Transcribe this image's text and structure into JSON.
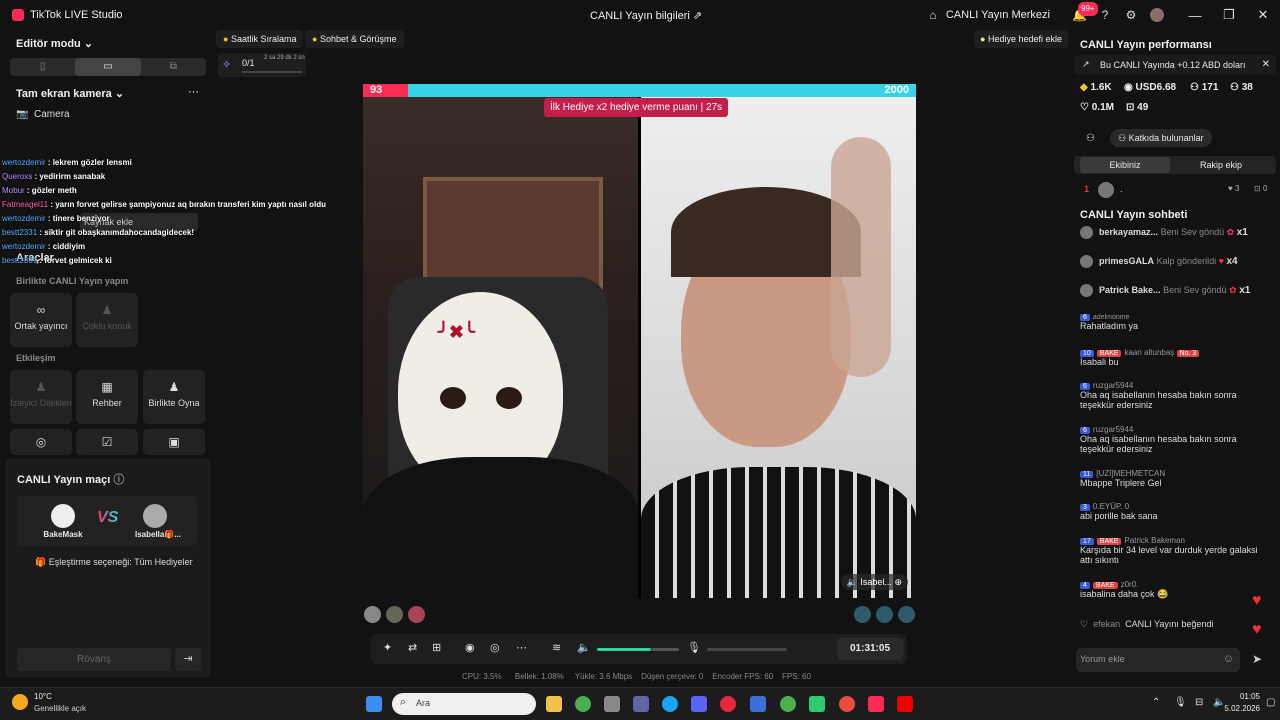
{
  "app": {
    "title": "TikTok LIVE Studio",
    "window_title": "CANLI Yayın bilgileri",
    "live_center": "CANLI Yayın Merkezi",
    "notif_count": "99+"
  },
  "left": {
    "editor_mode": "Editör modu",
    "camera_section": "Tam ekran kamera",
    "camera_item": "Camera",
    "add_source_tip": "Kaynak ekle",
    "tools_title": "Araçlar",
    "together_title": "Birlikte CANLI Yayın yapın",
    "tools_together": [
      {
        "label": "Ortak yayıncı",
        "icon": "∞",
        "enabled": true
      },
      {
        "label": "Çoklu konuk",
        "icon": "♟",
        "enabled": false
      }
    ],
    "interaction_title": "Etkileşim",
    "tools_interaction": [
      {
        "label": "İzleyici Dilekleri",
        "icon": "♟",
        "enabled": false
      },
      {
        "label": "Rehber",
        "icon": "▦",
        "enabled": true
      },
      {
        "label": "Birlikte Oyna",
        "icon": "♟",
        "enabled": true
      }
    ],
    "match_title": "CANLI Yayın maçı",
    "player_left": "BakeMask",
    "player_right": "Isabella🎁...",
    "vs": "VS",
    "pairing": "Eşleştirme seçeneği: Tüm Hediyeler",
    "rematch": "Rövanş"
  },
  "overlay_chat": [
    {
      "user": "wertozdemir",
      "msg": ": lekrem gözler lensmi"
    },
    {
      "user": "Queroxs",
      "msg": ": yedirirm sanabak"
    },
    {
      "user": "Mobur",
      "msg": ": gözler meth"
    },
    {
      "user": "Fatmeagel11",
      "msg": ": yarın forvet gelirse şampiyonuz aq bırakın transferi kim yaptı nasıl oldu"
    },
    {
      "user": "wertozdemir",
      "msg": ": tinere benziyor"
    },
    {
      "user": "bestt2331",
      "msg": ": siktir git obaşkanımdahocandagidecek!"
    },
    {
      "user": "wertozdemir",
      "msg": ": ciddiyim"
    },
    {
      "user": "bestt2331",
      "msg": ": forvet gelmicek ki"
    }
  ],
  "top_tabs": {
    "hourly": "Saatlik Sıralama",
    "chat_meet": "Sohbet & Görüşme",
    "goal": "0/1",
    "goal_timer": "2 sa 29 dk 2 sn",
    "add_gift_goal": "Hediye hedefi ekle"
  },
  "stage": {
    "score_left": "93",
    "score_right": "2000",
    "hint": "İlk Hediye x2 hediye verme puanı | 27s",
    "guest_label": "Isabel...",
    "timer": "01:31:05"
  },
  "stats": {
    "cpu": "CPU: 3.5%",
    "mem": "Bellek: 1.08%",
    "upload": "Yükle: 3.6 Mbps",
    "dropped": "Düşen çerçeve: 0",
    "encoder_fps": "Encoder FPS: 60",
    "fps": "FPS: 60"
  },
  "right": {
    "perf_title": "CANLI Yayın performansı",
    "perf_note": "Bu CANLI Yayında +0.12 ABD doları",
    "coins": "1.6K",
    "usd": "USD6.68",
    "viewers": "171",
    "followers": "38",
    "likes": "0.1M",
    "gifts": "49",
    "contributors": "Katkıda bulunanlar",
    "tab_ours": "Ekibiniz",
    "tab_rival": "Rakip ekip",
    "rank_1": "1",
    "rank_name": ".",
    "rank_hearts": "3",
    "rank_gifts": "0",
    "chat_title": "CANLI Yayın sohbeti",
    "gift_events": [
      {
        "user": "berkayamaz...",
        "msg": "Beni Sev göndü",
        "count": "x1"
      },
      {
        "user": "primesGALA",
        "msg": "Kalp gönderildi",
        "count": "x4"
      },
      {
        "user": "Patrick Bake...",
        "msg": "Beni Sev göndü",
        "count": "x1"
      }
    ],
    "chat": [
      {
        "level": "6",
        "user": "adelmonme",
        "msg": "Rahatladım ya",
        "fan": ""
      },
      {
        "level": "10",
        "user": "kaan altunbaş",
        "msg": "İsabali bu",
        "fan": "BAKE",
        "rank": "No. 3"
      },
      {
        "level": "6",
        "user": "ruzgar5944",
        "msg": "Oha aq isabellanın hesaba bakın sonra teşekkür edersiniz",
        "fan": ""
      },
      {
        "level": "6",
        "user": "ruzgar5944",
        "msg": "Oha aq isabellanın hesaba bakın sonra teşekkür edersiniz",
        "fan": ""
      },
      {
        "level": "11",
        "user": "[UZİ]MEHMETCAN",
        "msg": "Mbappe Triplere Gel",
        "fan": ""
      },
      {
        "level": "3",
        "user": "0.EYÜP. 0",
        "msg": "abi porille bak sana",
        "fan": ""
      },
      {
        "level": "17",
        "user": "Patrick Bakeman",
        "msg": "Karşıda bir 34 level var durduk yerde galaksi attı sıkıntı",
        "fan": "BAKE"
      },
      {
        "level": "4",
        "user": "z0r0.",
        "msg": "isabalina daha çok 😂",
        "fan": "BAKE"
      }
    ],
    "liked_user": "efekan",
    "liked_msg": "CANLI Yayını beğendi",
    "comment_placeholder": "Yorum ekle"
  },
  "taskbar": {
    "weather_temp": "10°C",
    "weather_desc": "Genellikle açık",
    "search": "Ara",
    "time": "01:05",
    "date": "5.02.2026"
  }
}
